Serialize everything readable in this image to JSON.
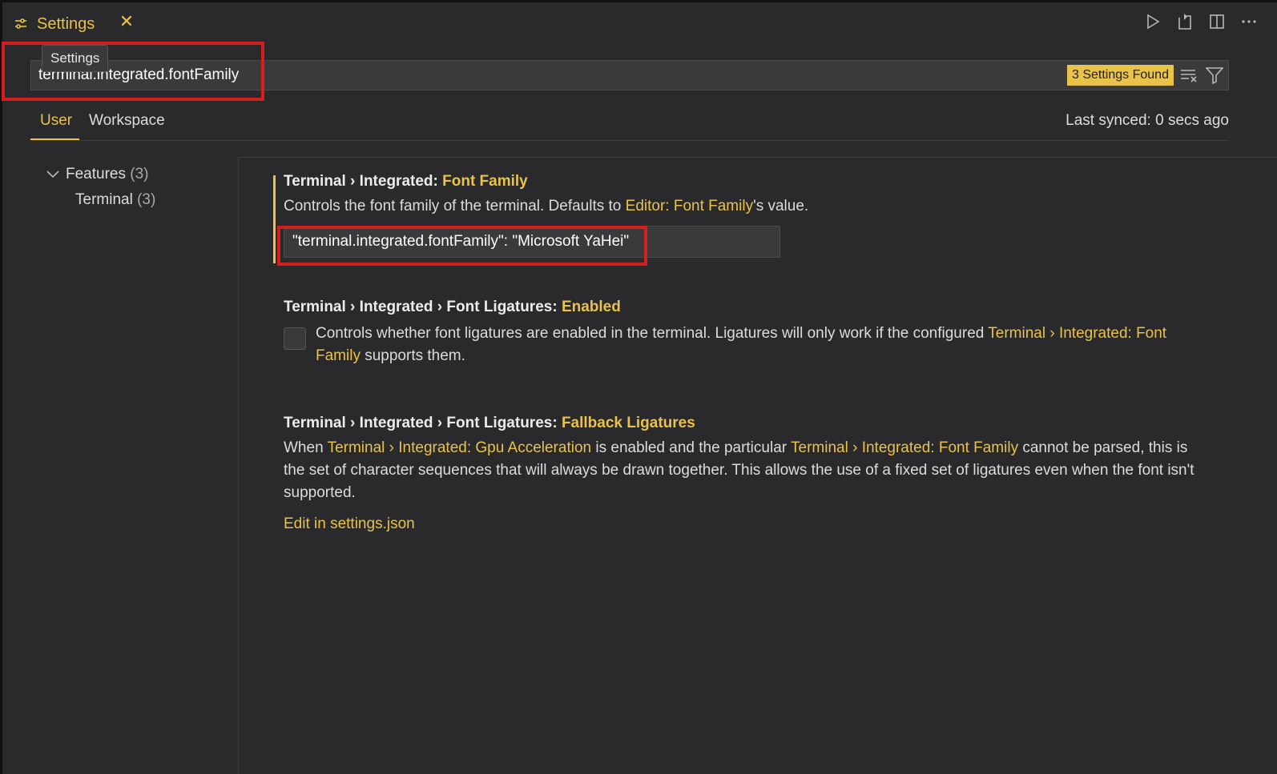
{
  "tab": {
    "label": "Settings",
    "tooltip": "Settings"
  },
  "search": {
    "value": "terminal.integrated.fontFamily",
    "badge": "3 Settings Found"
  },
  "scope": {
    "user": "User",
    "workspace": "Workspace",
    "sync": "Last synced: 0 secs ago"
  },
  "tree": {
    "features": {
      "label": "Features",
      "count": "(3)"
    },
    "terminal": {
      "label": "Terminal",
      "count": "(3)"
    }
  },
  "settings": [
    {
      "title_prefix": "Terminal › Integrated: ",
      "title_key": "Font Family",
      "desc_pre": "Controls the font family of the terminal. Defaults to ",
      "desc_link": "Editor: Font Family",
      "desc_post": "'s value.",
      "value": "\"terminal.integrated.fontFamily\": \"Microsoft YaHei\""
    },
    {
      "title_prefix": "Terminal › Integrated › Font Ligatures: ",
      "title_key": "Enabled",
      "desc_pre": "Controls whether font ligatures are enabled in the terminal. Ligatures will only work if the configured ",
      "desc_link": "Terminal › Integrated: Font Family",
      "desc_post": " supports them."
    },
    {
      "title_prefix": "Terminal › Integrated › Font Ligatures: ",
      "title_key": "Fallback Ligatures",
      "desc_pre": "When ",
      "desc_link1": "Terminal › Integrated: Gpu Acceleration",
      "desc_mid": " is enabled and the particular ",
      "desc_link2": "Terminal › Integrated: Font Family",
      "desc_post": " cannot be parsed, this is the set of character sequences that will always be drawn together. This allows the use of a fixed set of ligatures even when the font isn't supported.",
      "edit_link": "Edit in settings.json"
    }
  ],
  "colors": {
    "accent": "#e8c24a",
    "annotation": "#d41f1f",
    "background": "#2a2a2d"
  }
}
